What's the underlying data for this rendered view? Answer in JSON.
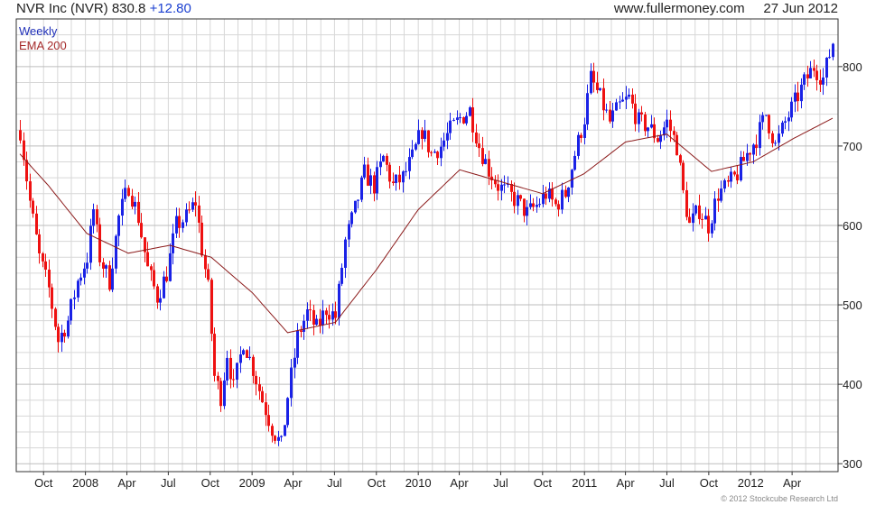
{
  "header": {
    "title": "NVR Inc (NVR) 830.8",
    "change": "+12.80",
    "site": "www.fullermoney.com",
    "date": "27 Jun 2012"
  },
  "footer": {
    "copyright": "© 2012 Stockcube Research Ltd"
  },
  "colors": {
    "up": "#1a22e6",
    "down": "#ee1111",
    "ema": "#8b1a1a",
    "grid": "#d7d7d7",
    "frame": "#333333"
  },
  "chart_data": {
    "type": "bar",
    "legend": [
      "Weekly",
      "EMA 200"
    ],
    "legend_position": "top-left",
    "grid": true,
    "ylim": [
      290,
      860
    ],
    "yticks": [
      300,
      400,
      500,
      600,
      700,
      800
    ],
    "x_start": "2007-08-10",
    "x_end": "2012-06-29",
    "xticks": [
      {
        "label": "Oct",
        "date": "2007-10-01"
      },
      {
        "label": "2008",
        "date": "2008-01-01"
      },
      {
        "label": "Apr",
        "date": "2008-04-01"
      },
      {
        "label": "Jul",
        "date": "2008-07-01"
      },
      {
        "label": "Oct",
        "date": "2008-10-01"
      },
      {
        "label": "2009",
        "date": "2009-01-01"
      },
      {
        "label": "Apr",
        "date": "2009-04-01"
      },
      {
        "label": "Jul",
        "date": "2009-07-01"
      },
      {
        "label": "Oct",
        "date": "2009-10-01"
      },
      {
        "label": "2010",
        "date": "2010-01-01"
      },
      {
        "label": "Apr",
        "date": "2010-04-01"
      },
      {
        "label": "Jul",
        "date": "2010-07-01"
      },
      {
        "label": "Oct",
        "date": "2010-10-01"
      },
      {
        "label": "2011",
        "date": "2011-01-01"
      },
      {
        "label": "Apr",
        "date": "2011-04-01"
      },
      {
        "label": "Jul",
        "date": "2011-07-01"
      },
      {
        "label": "Oct",
        "date": "2011-10-01"
      },
      {
        "label": "2012",
        "date": "2012-01-01"
      },
      {
        "label": "Apr",
        "date": "2012-04-01"
      }
    ],
    "close_anchors": [
      [
        "2007-08-10",
        720
      ],
      [
        "2007-08-31",
        630
      ],
      [
        "2007-09-21",
        560
      ],
      [
        "2007-10-12",
        520
      ],
      [
        "2007-11-02",
        455
      ],
      [
        "2007-11-23",
        480
      ],
      [
        "2007-12-14",
        530
      ],
      [
        "2008-01-04",
        560
      ],
      [
        "2008-01-18",
        620
      ],
      [
        "2008-02-01",
        560
      ],
      [
        "2008-02-22",
        530
      ],
      [
        "2008-03-14",
        610
      ],
      [
        "2008-04-04",
        650
      ],
      [
        "2008-04-25",
        610
      ],
      [
        "2008-05-16",
        545
      ],
      [
        "2008-06-06",
        510
      ],
      [
        "2008-06-27",
        540
      ],
      [
        "2008-07-18",
        600
      ],
      [
        "2008-08-08",
        610
      ],
      [
        "2008-08-29",
        630
      ],
      [
        "2008-09-12",
        570
      ],
      [
        "2008-09-26",
        520
      ],
      [
        "2008-10-10",
        410
      ],
      [
        "2008-10-24",
        385
      ],
      [
        "2008-11-07",
        440
      ],
      [
        "2008-11-21",
        395
      ],
      [
        "2008-12-12",
        455
      ],
      [
        "2009-01-02",
        420
      ],
      [
        "2009-01-23",
        380
      ],
      [
        "2009-02-13",
        345
      ],
      [
        "2009-03-06",
        322
      ],
      [
        "2009-03-20",
        385
      ],
      [
        "2009-04-10",
        460
      ],
      [
        "2009-05-01",
        490
      ],
      [
        "2009-05-22",
        470
      ],
      [
        "2009-06-12",
        495
      ],
      [
        "2009-07-03",
        485
      ],
      [
        "2009-07-24",
        580
      ],
      [
        "2009-08-14",
        620
      ],
      [
        "2009-09-04",
        665
      ],
      [
        "2009-09-25",
        650
      ],
      [
        "2009-10-16",
        685
      ],
      [
        "2009-11-06",
        650
      ],
      [
        "2009-11-27",
        660
      ],
      [
        "2009-12-18",
        685
      ],
      [
        "2010-01-08",
        720
      ],
      [
        "2010-01-29",
        690
      ],
      [
        "2010-02-19",
        700
      ],
      [
        "2010-03-12",
        720
      ],
      [
        "2010-04-02",
        735
      ],
      [
        "2010-04-23",
        745
      ],
      [
        "2010-05-14",
        700
      ],
      [
        "2010-06-04",
        670
      ],
      [
        "2010-06-25",
        650
      ],
      [
        "2010-07-16",
        640
      ],
      [
        "2010-08-06",
        630
      ],
      [
        "2010-08-27",
        615
      ],
      [
        "2010-09-17",
        625
      ],
      [
        "2010-10-08",
        640
      ],
      [
        "2010-10-29",
        625
      ],
      [
        "2010-11-19",
        640
      ],
      [
        "2010-12-10",
        690
      ],
      [
        "2010-12-31",
        735
      ],
      [
        "2011-01-14",
        785
      ],
      [
        "2011-02-04",
        760
      ],
      [
        "2011-02-25",
        730
      ],
      [
        "2011-03-18",
        750
      ],
      [
        "2011-04-08",
        760
      ],
      [
        "2011-04-29",
        730
      ],
      [
        "2011-05-20",
        725
      ],
      [
        "2011-06-10",
        710
      ],
      [
        "2011-07-01",
        730
      ],
      [
        "2011-07-22",
        700
      ],
      [
        "2011-08-05",
        640
      ],
      [
        "2011-08-19",
        600
      ],
      [
        "2011-09-09",
        620
      ],
      [
        "2011-09-30",
        600
      ],
      [
        "2011-10-21",
        640
      ],
      [
        "2011-11-11",
        650
      ],
      [
        "2011-12-02",
        665
      ],
      [
        "2011-12-23",
        690
      ],
      [
        "2012-01-13",
        710
      ],
      [
        "2012-02-03",
        740
      ],
      [
        "2012-02-24",
        700
      ],
      [
        "2012-03-16",
        730
      ],
      [
        "2012-04-06",
        755
      ],
      [
        "2012-04-27",
        780
      ],
      [
        "2012-05-18",
        800
      ],
      [
        "2012-06-08",
        785
      ],
      [
        "2012-06-29",
        831
      ]
    ],
    "ema_anchors": [
      [
        "2007-08-10",
        690
      ],
      [
        "2007-10-12",
        650
      ],
      [
        "2008-01-04",
        590
      ],
      [
        "2008-04-04",
        565
      ],
      [
        "2008-07-04",
        575
      ],
      [
        "2008-10-03",
        560
      ],
      [
        "2009-01-02",
        515
      ],
      [
        "2009-03-20",
        465
      ],
      [
        "2009-07-03",
        478
      ],
      [
        "2009-10-02",
        545
      ],
      [
        "2010-01-01",
        620
      ],
      [
        "2010-04-02",
        670
      ],
      [
        "2010-07-02",
        655
      ],
      [
        "2010-10-01",
        640
      ],
      [
        "2010-12-31",
        665
      ],
      [
        "2011-04-01",
        705
      ],
      [
        "2011-07-01",
        715
      ],
      [
        "2011-10-07",
        668
      ],
      [
        "2012-01-06",
        680
      ],
      [
        "2012-04-06",
        710
      ],
      [
        "2012-06-29",
        735
      ]
    ]
  }
}
